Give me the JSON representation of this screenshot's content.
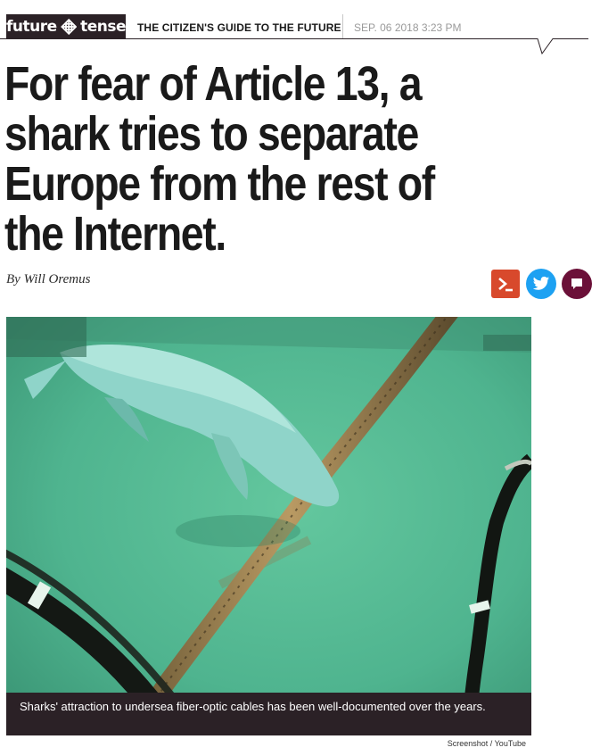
{
  "header": {
    "brand": {
      "left": "future",
      "right": "tense",
      "icon": "tangled-knot-icon"
    },
    "tagline": "THE CITIZEN'S GUIDE TO THE FUTURE",
    "date": "SEP. 06 2018 3:23 PM"
  },
  "article": {
    "headline_lines": [
      "For fear of Article 13, a",
      "shark tries to separate",
      "Europe from the rest of",
      "the Internet."
    ],
    "byline_prefix": "By",
    "author": "Will Oremus"
  },
  "share": {
    "buttons": [
      {
        "icon": "slate-plus-icon",
        "color": "#d8492c"
      },
      {
        "icon": "twitter-icon",
        "color": "#1da1f2"
      },
      {
        "icon": "comment-icon",
        "color": "#6b1038"
      }
    ]
  },
  "image": {
    "caption": "Sharks' attraction to undersea fiber-optic cables has been well-documented over the years.",
    "credit": "Screenshot / YouTube"
  }
}
